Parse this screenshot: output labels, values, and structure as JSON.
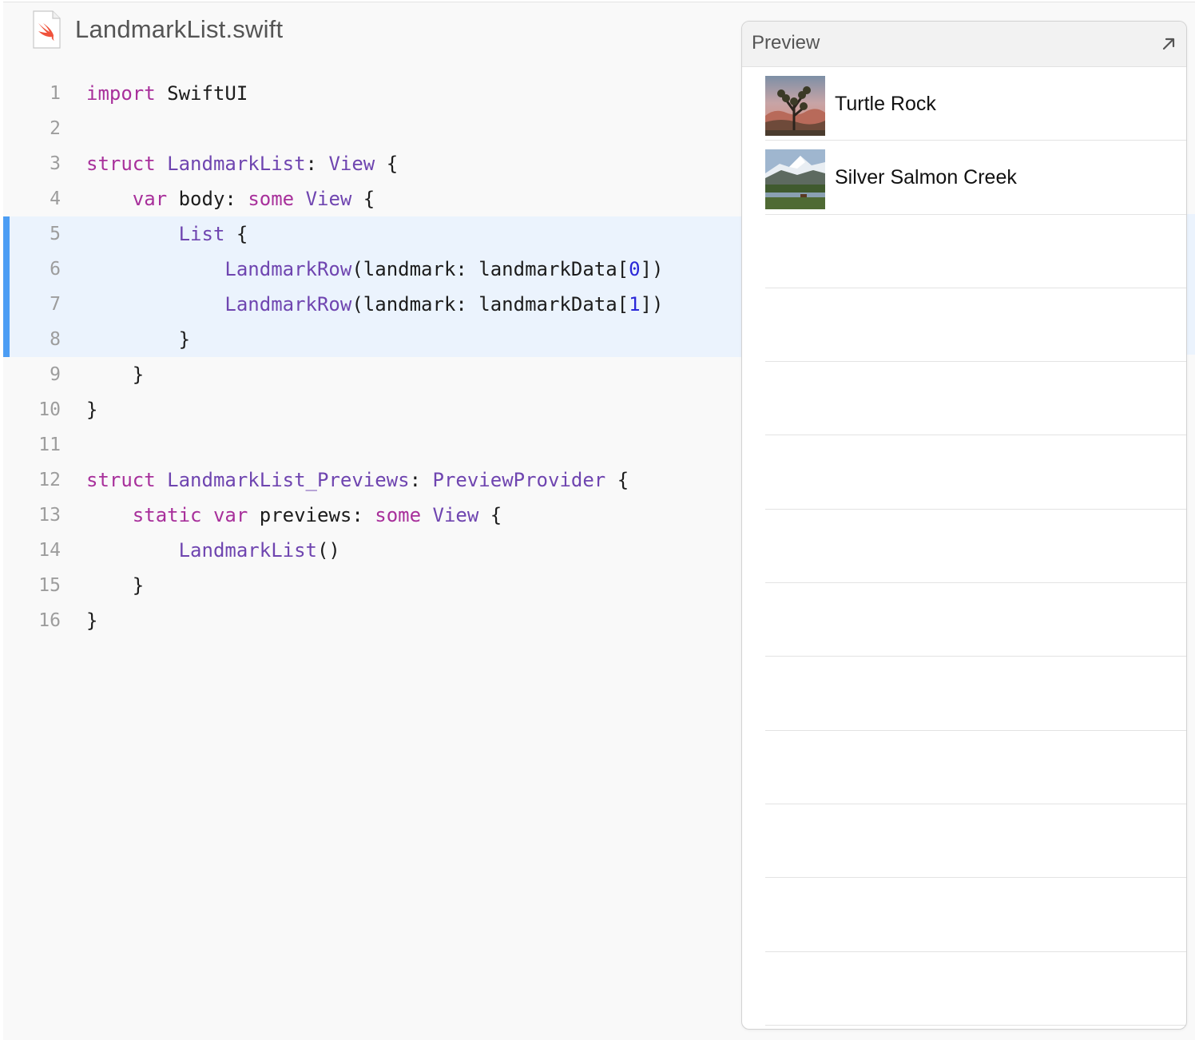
{
  "file": {
    "title": "LandmarkList.swift",
    "icon": "swift-file-icon"
  },
  "code": {
    "highlighted_lines": [
      5,
      6,
      7,
      8
    ],
    "lines": [
      {
        "num": "1",
        "tokens": [
          [
            "kw",
            "import"
          ],
          [
            "pl",
            " SwiftUI"
          ]
        ]
      },
      {
        "num": "2",
        "tokens": []
      },
      {
        "num": "3",
        "tokens": [
          [
            "kw",
            "struct"
          ],
          [
            "pl",
            " "
          ],
          [
            "ty",
            "LandmarkList"
          ],
          [
            "pl",
            ": "
          ],
          [
            "ty",
            "View"
          ],
          [
            "pl",
            " {"
          ]
        ]
      },
      {
        "num": "4",
        "tokens": [
          [
            "pl",
            "    "
          ],
          [
            "kw",
            "var"
          ],
          [
            "pl",
            " body: "
          ],
          [
            "kw",
            "some"
          ],
          [
            "pl",
            " "
          ],
          [
            "ty",
            "View"
          ],
          [
            "pl",
            " {"
          ]
        ]
      },
      {
        "num": "5",
        "tokens": [
          [
            "pl",
            "        "
          ],
          [
            "ty",
            "List"
          ],
          [
            "pl",
            " {"
          ]
        ]
      },
      {
        "num": "6",
        "tokens": [
          [
            "pl",
            "            "
          ],
          [
            "ty",
            "LandmarkRow"
          ],
          [
            "pl",
            "(landmark: landmarkData["
          ],
          [
            "nm",
            "0"
          ],
          [
            "pl",
            "])"
          ]
        ]
      },
      {
        "num": "7",
        "tokens": [
          [
            "pl",
            "            "
          ],
          [
            "ty",
            "LandmarkRow"
          ],
          [
            "pl",
            "(landmark: landmarkData["
          ],
          [
            "nm",
            "1"
          ],
          [
            "pl",
            "])"
          ]
        ]
      },
      {
        "num": "8",
        "tokens": [
          [
            "pl",
            "        }"
          ]
        ]
      },
      {
        "num": "9",
        "tokens": [
          [
            "pl",
            "    }"
          ]
        ]
      },
      {
        "num": "10",
        "tokens": [
          [
            "pl",
            "}"
          ]
        ]
      },
      {
        "num": "11",
        "tokens": []
      },
      {
        "num": "12",
        "tokens": [
          [
            "kw",
            "struct"
          ],
          [
            "pl",
            " "
          ],
          [
            "ty",
            "LandmarkList_Previews"
          ],
          [
            "pl",
            ": "
          ],
          [
            "ty",
            "PreviewProvider"
          ],
          [
            "pl",
            " {"
          ]
        ]
      },
      {
        "num": "13",
        "tokens": [
          [
            "pl",
            "    "
          ],
          [
            "kw",
            "static"
          ],
          [
            "pl",
            " "
          ],
          [
            "kw",
            "var"
          ],
          [
            "pl",
            " previews: "
          ],
          [
            "kw",
            "some"
          ],
          [
            "pl",
            " "
          ],
          [
            "ty",
            "View"
          ],
          [
            "pl",
            " {"
          ]
        ]
      },
      {
        "num": "14",
        "tokens": [
          [
            "pl",
            "        "
          ],
          [
            "ty",
            "LandmarkList"
          ],
          [
            "pl",
            "()"
          ]
        ]
      },
      {
        "num": "15",
        "tokens": [
          [
            "pl",
            "    }"
          ]
        ]
      },
      {
        "num": "16",
        "tokens": [
          [
            "pl",
            "}"
          ]
        ]
      }
    ]
  },
  "preview": {
    "title": "Preview",
    "expand_icon": "arrow-up-right-icon",
    "rows": [
      {
        "label": "Turtle Rock",
        "thumb": "turtle-rock-photo"
      },
      {
        "label": "Silver Salmon Creek",
        "thumb": "silver-salmon-creek-photo"
      },
      {
        "label": ""
      },
      {
        "label": ""
      },
      {
        "label": ""
      },
      {
        "label": ""
      },
      {
        "label": ""
      },
      {
        "label": ""
      },
      {
        "label": ""
      },
      {
        "label": ""
      },
      {
        "label": ""
      },
      {
        "label": ""
      },
      {
        "label": ""
      }
    ]
  },
  "colors": {
    "keyword": "#a8309b",
    "type": "#6f45b0",
    "number": "#2a27d8",
    "highlight_bg": "#ebf3fd",
    "highlight_bar": "#4c9df4"
  }
}
